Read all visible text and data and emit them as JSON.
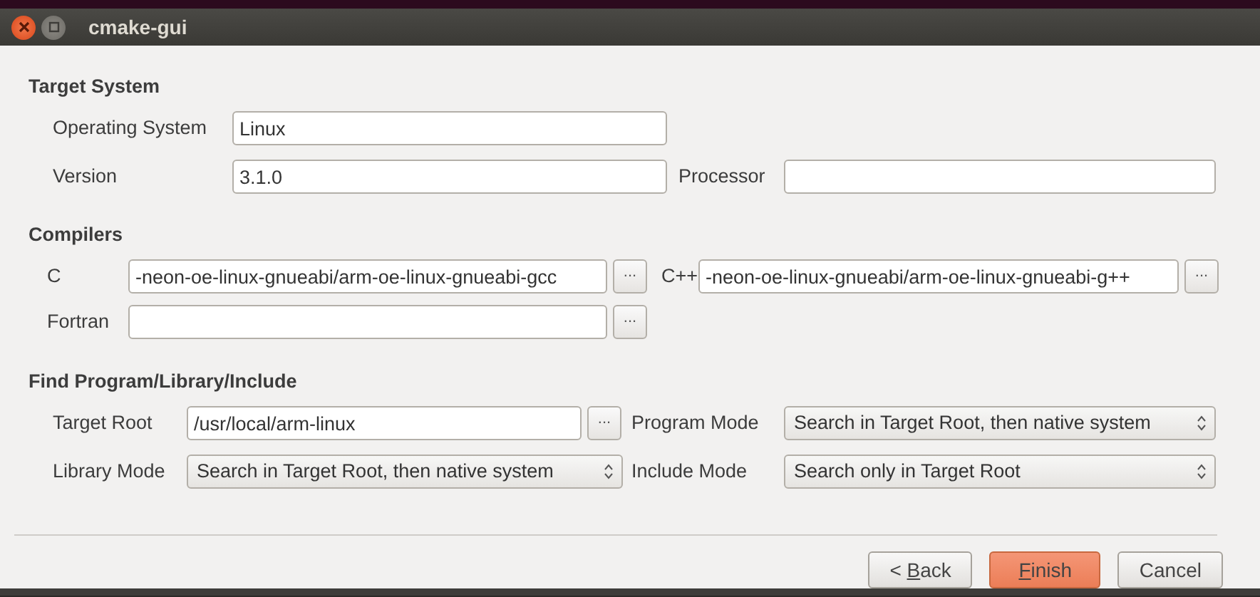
{
  "window": {
    "title": "cmake-gui"
  },
  "sections": [
    {
      "title": "Target System",
      "rows": [
        {
          "items": [
            {
              "kind": "label",
              "text": "Operating System"
            },
            {
              "kind": "text",
              "value": "Linux"
            }
          ]
        },
        {
          "items": [
            {
              "kind": "label",
              "text": "Version"
            },
            {
              "kind": "text",
              "value": "3.1.0"
            },
            {
              "kind": "label",
              "text": "Processor"
            },
            {
              "kind": "text",
              "value": ""
            }
          ]
        }
      ]
    },
    {
      "title": "Compilers",
      "rows": [
        {
          "items": [
            {
              "kind": "label",
              "text": "C"
            },
            {
              "kind": "text",
              "value": "-neon-oe-linux-gnueabi/arm-oe-linux-gnueabi-gcc"
            },
            {
              "kind": "browse",
              "text": "..."
            },
            {
              "kind": "label",
              "text": "C++"
            },
            {
              "kind": "text",
              "value": "-neon-oe-linux-gnueabi/arm-oe-linux-gnueabi-g++"
            },
            {
              "kind": "browse",
              "text": "..."
            }
          ]
        },
        {
          "items": [
            {
              "kind": "label",
              "text": "Fortran"
            },
            {
              "kind": "text",
              "value": ""
            },
            {
              "kind": "browse",
              "text": "..."
            }
          ]
        }
      ]
    },
    {
      "title": "Find Program/Library/Include",
      "rows": [
        {
          "items": [
            {
              "kind": "label",
              "text": "Target Root"
            },
            {
              "kind": "text",
              "value": "/usr/local/arm-linux"
            },
            {
              "kind": "browse",
              "text": "..."
            },
            {
              "kind": "label",
              "text": "Program Mode"
            },
            {
              "kind": "select",
              "value": "Search in Target Root, then native system"
            }
          ]
        },
        {
          "items": [
            {
              "kind": "label",
              "text": "Library Mode"
            },
            {
              "kind": "select",
              "value": "Search in Target Root, then native system"
            },
            {
              "kind": "label",
              "text": "Include Mode"
            },
            {
              "kind": "select",
              "value": "Search only in Target Root"
            }
          ]
        }
      ]
    }
  ],
  "buttons": [
    {
      "label": "< Back",
      "mnemonic_underlined": true,
      "default": false
    },
    {
      "label": "Finish",
      "mnemonic_underlined": true,
      "default": true
    },
    {
      "label": "Cancel",
      "mnemonic_underlined": false,
      "default": false
    }
  ]
}
